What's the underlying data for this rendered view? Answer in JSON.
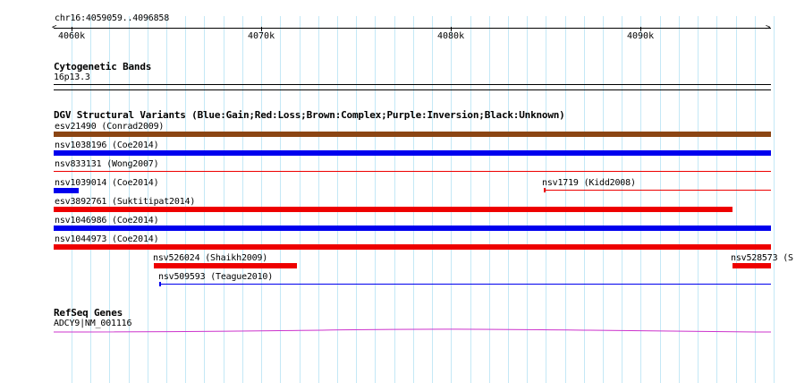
{
  "coordinate_label": "chr16:4059059..4096858",
  "ruler": {
    "ticks": [
      "4060k",
      "4070k",
      "4080k",
      "4090k"
    ],
    "range": [
      4059059,
      4096858
    ]
  },
  "tracks": {
    "cytoband": {
      "title": "Cytogenetic Bands",
      "band_label": "16p13.3"
    },
    "dgv": {
      "title": "DGV Structural Variants (Blue:Gain;Red:Loss;Brown:Complex;Purple:Inversion;Black:Unknown)",
      "legend_colors": {
        "gain": "#0000ee",
        "loss": "#ee0000",
        "complex": "#8b4513",
        "inversion": "#800080",
        "unknown": "#000000"
      },
      "features": [
        {
          "label": "esv21490 (Conrad2009)",
          "type": "complex",
          "start": 4059059,
          "end": 4096858,
          "style": "thick"
        },
        {
          "label": "nsv1038196 (Coe2014)",
          "type": "gain",
          "start": 4059059,
          "end": 4096858,
          "style": "thick"
        },
        {
          "label": "nsv833131 (Wong2007)",
          "type": "loss",
          "start": 4059059,
          "end": 4096858,
          "style": "thin"
        },
        {
          "label": "nsv1039014 (Coe2014)",
          "type": "gain",
          "start": 4059059,
          "end": 4060400,
          "style": "thick"
        },
        {
          "label": "nsv1719 (Kidd2008)",
          "type": "loss",
          "start": 4084900,
          "end": 4096858,
          "style": "thin"
        },
        {
          "label": "esv3892761 (Suktitipat2014)",
          "type": "loss",
          "start": 4059059,
          "end": 4094850,
          "style": "thick"
        },
        {
          "label": "nsv1046986 (Coe2014)",
          "type": "gain",
          "start": 4059059,
          "end": 4096858,
          "style": "thick"
        },
        {
          "label": "nsv1044973 (Coe2014)",
          "type": "loss",
          "start": 4059059,
          "end": 4096858,
          "style": "thick"
        },
        {
          "label": "nsv526024 (Shaikh2009)",
          "type": "loss",
          "start": 4064350,
          "end": 4071900,
          "style": "thick"
        },
        {
          "label": "nsv528573 (S",
          "type": "loss",
          "start": 4094850,
          "end": 4096858,
          "style": "thick"
        },
        {
          "label": "nsv509593 (Teague2010)",
          "type": "gain",
          "start": 4064600,
          "end": 4096858,
          "style": "thin"
        }
      ]
    },
    "refseq": {
      "title": "RefSeq Genes",
      "gene_label": "ADCY9|NM_001116",
      "color": "#cc33cc"
    }
  }
}
